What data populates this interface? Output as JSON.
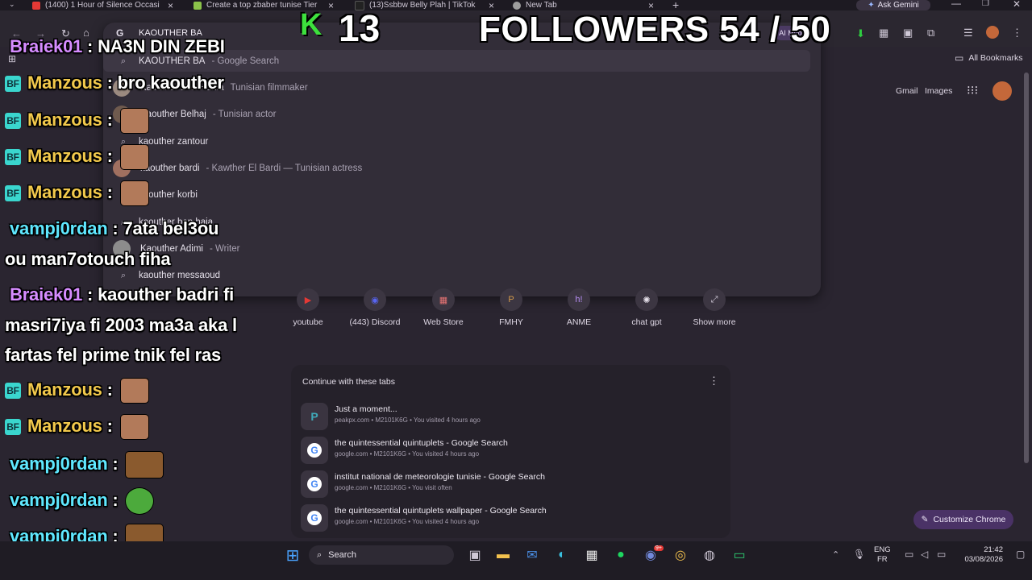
{
  "tabs": [
    {
      "title": "(1400) 1 Hour of Silence Occasi",
      "color": "#e53935"
    },
    {
      "title": "Create a top zbaber tunise Tier",
      "color": "#8bc34a"
    },
    {
      "title": "(13)Ssbbw Belly Plah | TikTok",
      "color": "#222222"
    },
    {
      "title": "New Tab",
      "color": "#9e9e9e"
    }
  ],
  "ask_gemini": "Ask Gemini",
  "omnibox": {
    "value": "KAOUTHER BA",
    "suggestions": [
      {
        "text": "KAOUTHER BA",
        "sub": "- Google Search",
        "icon": "search-icon"
      },
      {
        "text": "Kaouther Ben Hania",
        "sub": "Tunisian filmmaker",
        "icon": "avatar"
      },
      {
        "text": "Kaouther Belhaj",
        "sub": "- Tunisian actor",
        "icon": "avatar"
      },
      {
        "text": "kaouther zantour",
        "sub": "",
        "icon": "search-icon"
      },
      {
        "text": "kaouther bardi",
        "sub": "- Kawther El Bardi — Tunisian actress",
        "icon": "avatar"
      },
      {
        "text": "kaouther korbi",
        "sub": "",
        "icon": "search-icon"
      },
      {
        "text": "kaouther ben haja",
        "sub": "",
        "icon": "search-icon"
      },
      {
        "text": "Kaouther Adimi",
        "sub": "- Writer",
        "icon": "avatar"
      },
      {
        "text": "kaouther messaoud",
        "sub": "",
        "icon": "search-icon"
      }
    ]
  },
  "ai_mode": "AI Mode",
  "all_bookmarks": "All Bookmarks",
  "header_links": {
    "gmail": "Gmail",
    "images": "Images"
  },
  "shortcuts": [
    {
      "label": "youtube",
      "glyph": "▶",
      "color": "#e53935"
    },
    {
      "label": "(443) Discord",
      "glyph": "◉",
      "color": "#5865f2"
    },
    {
      "label": "Web Store",
      "glyph": "▦",
      "color": "#e57373"
    },
    {
      "label": "FMHY",
      "glyph": "P",
      "color": "#9c6b2e"
    },
    {
      "label": "ANME",
      "glyph": "h!",
      "color": "#8e5fd6"
    },
    {
      "label": "chat gpt",
      "glyph": "✺",
      "color": "#e6e1ea"
    },
    {
      "label": "Show more",
      "glyph": "⤢",
      "color": "#cfc8d6"
    }
  ],
  "continue_card": {
    "heading": "Continue with these tabs",
    "rows": [
      {
        "title": "Just a moment...",
        "meta": "peakpx.com • M2101K6G • You visited 4 hours ago"
      },
      {
        "title": "the quintessential quintuplets - Google Search",
        "meta": "google.com • M2101K6G • You visited 4 hours ago"
      },
      {
        "title": "institut national de meteorologie tunisie - Google Search",
        "meta": "google.com • M2101K6G • You visit often"
      },
      {
        "title": "the quintessential quintuplets wallpaper - Google Search",
        "meta": "google.com • M2101K6G • You visited 4 hours ago"
      }
    ]
  },
  "customize_chrome": "Customize Chrome",
  "overlay": {
    "followers": "FOLLOWERS 54 / 50",
    "k_letter": "K",
    "k_number": "13"
  },
  "chat": [
    {
      "user": "Braiek01",
      "msg": "NA3N DIN ZEBI"
    },
    {
      "user": "Manzous",
      "msg": "bro kaouther"
    },
    {
      "user": "Manzous",
      "msg": ""
    },
    {
      "user": "Manzous",
      "msg": ""
    },
    {
      "user": "Manzous",
      "msg": ""
    },
    {
      "user": "vampj0rdan",
      "msg": "7ata bel3ou"
    },
    {
      "user": "",
      "msg": "ou man7otouch fiha"
    },
    {
      "user": "Braiek01",
      "msg": "kaouther badri fi"
    },
    {
      "user": "",
      "msg": "masri7iya fi 2003 ma3a aka l"
    },
    {
      "user": "",
      "msg": "fartas fel prime tnik fel ras"
    },
    {
      "user": "Manzous",
      "msg": ""
    },
    {
      "user": "Manzous",
      "msg": ""
    },
    {
      "user": "vampj0rdan",
      "msg": ""
    },
    {
      "user": "vampj0rdan",
      "msg": ""
    },
    {
      "user": "vampj0rdan",
      "msg": ""
    }
  ],
  "taskbar": {
    "search_label": "Search",
    "lang_top": "ENG",
    "lang_bottom": "FR",
    "time": "21:42",
    "date": "03/08/2026",
    "discord_badge": "9+"
  }
}
